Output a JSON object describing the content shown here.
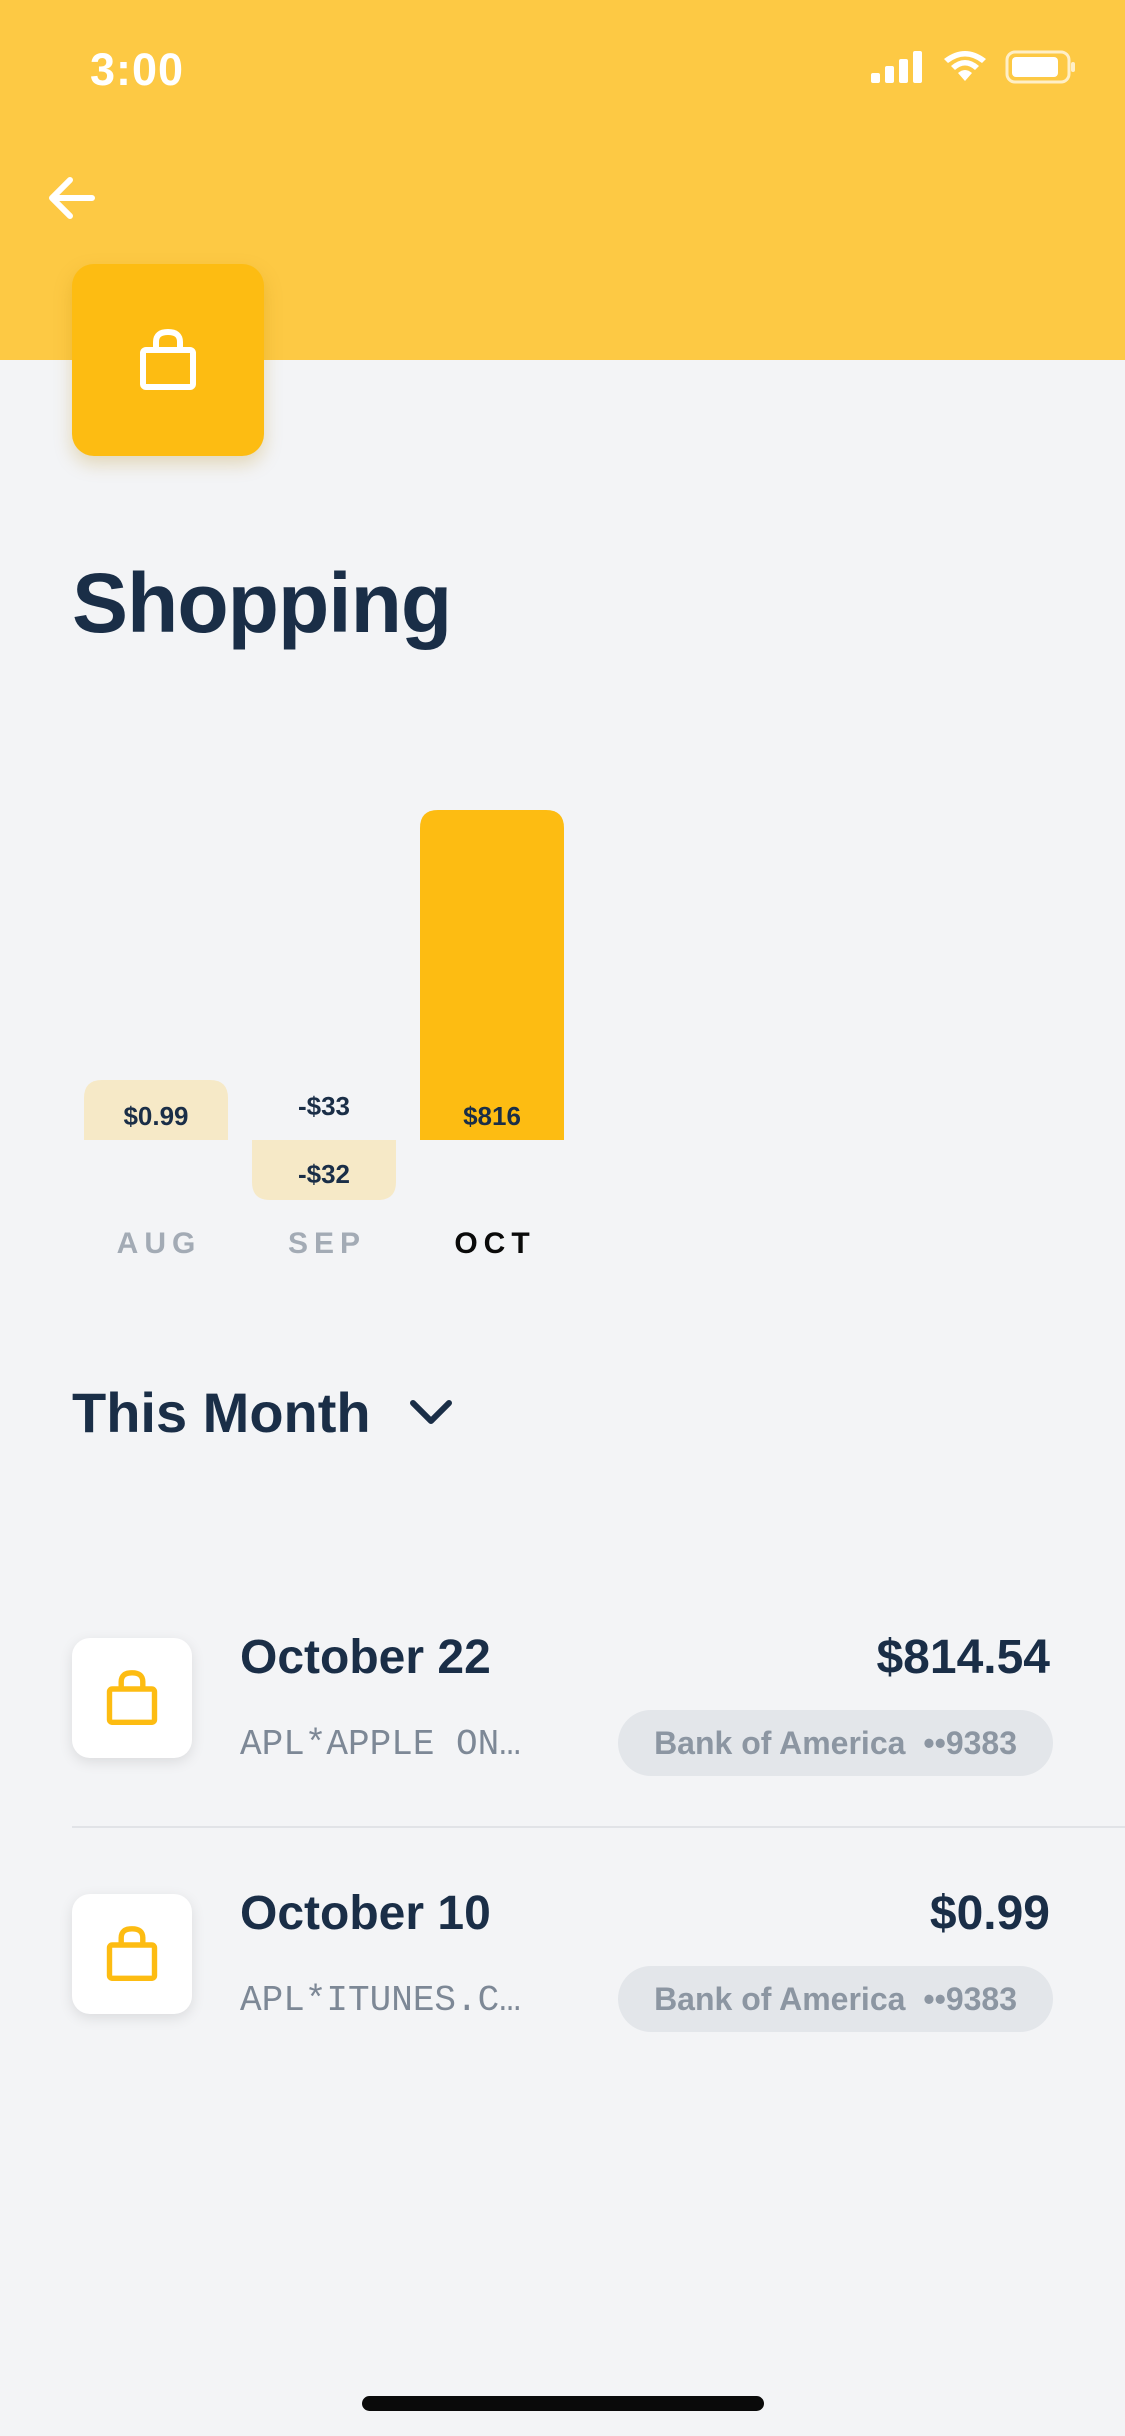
{
  "status_bar": {
    "time": "3:00"
  },
  "header": {
    "back_icon": "arrow-left-icon",
    "category_icon": "shopping-bag-icon",
    "accent_color": "#FDC944"
  },
  "page": {
    "title": "Shopping"
  },
  "chart_data": {
    "type": "bar",
    "categories": [
      "AUG",
      "SEP",
      "OCT"
    ],
    "values": [
      0.99,
      -32,
      816
    ],
    "value_labels": [
      "$0.99",
      "-$32",
      "$816"
    ],
    "ghost_label": "-$33",
    "selected": "OCT"
  },
  "period": {
    "label": "This Month",
    "chevron_icon": "chevron-down-icon"
  },
  "transactions": [
    {
      "date": "October 22",
      "amount": "$814.54",
      "merchant": "APL*APPLE ON…",
      "account": "Bank of America",
      "mask": "••9383",
      "icon": "shopping-bag-icon"
    },
    {
      "date": "October 10",
      "amount": "$0.99",
      "merchant": "APL*ITUNES.C…",
      "account": "Bank of America",
      "mask": "••9383",
      "icon": "shopping-bag-icon"
    }
  ]
}
